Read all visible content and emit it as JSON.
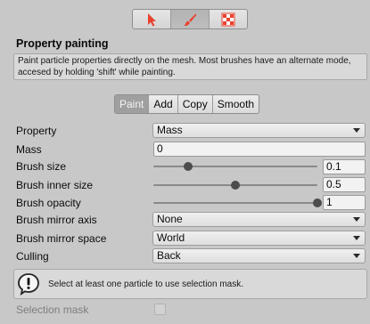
{
  "toolbar": {
    "modes": [
      {
        "icon": "cursor-arrow-icon",
        "active": false
      },
      {
        "icon": "paintbrush-icon",
        "active": true
      },
      {
        "icon": "checker-grid-icon",
        "active": false
      }
    ],
    "accent_color": "#e8422e"
  },
  "section": {
    "title": "Property painting",
    "help": "Paint particle properties directly on the mesh. Most brushes have an alternate mode, accesed by holding 'shift' while painting."
  },
  "tool_tabs": [
    "Paint",
    "Add",
    "Copy",
    "Smooth"
  ],
  "active_tab": "Paint",
  "fields": {
    "property": {
      "label": "Property",
      "value": "Mass"
    },
    "mass": {
      "label": "Mass",
      "value": "0"
    },
    "brush_size": {
      "label": "Brush size",
      "value": "0.1",
      "level": 0.21
    },
    "brush_inner_size": {
      "label": "Brush inner size",
      "value": "0.5",
      "level": 0.5
    },
    "brush_opacity": {
      "label": "Brush opacity",
      "value": "1",
      "level": 1.0
    },
    "brush_mirror_axis": {
      "label": "Brush mirror axis",
      "value": "None"
    },
    "brush_mirror_space": {
      "label": "Brush mirror space",
      "value": "World"
    },
    "culling": {
      "label": "Culling",
      "value": "Back"
    }
  },
  "warning": {
    "icon": "exclamation-icon",
    "text": "Select at least one particle to use selection mask."
  },
  "selection_mask": {
    "label": "Selection mask",
    "checked": false
  }
}
